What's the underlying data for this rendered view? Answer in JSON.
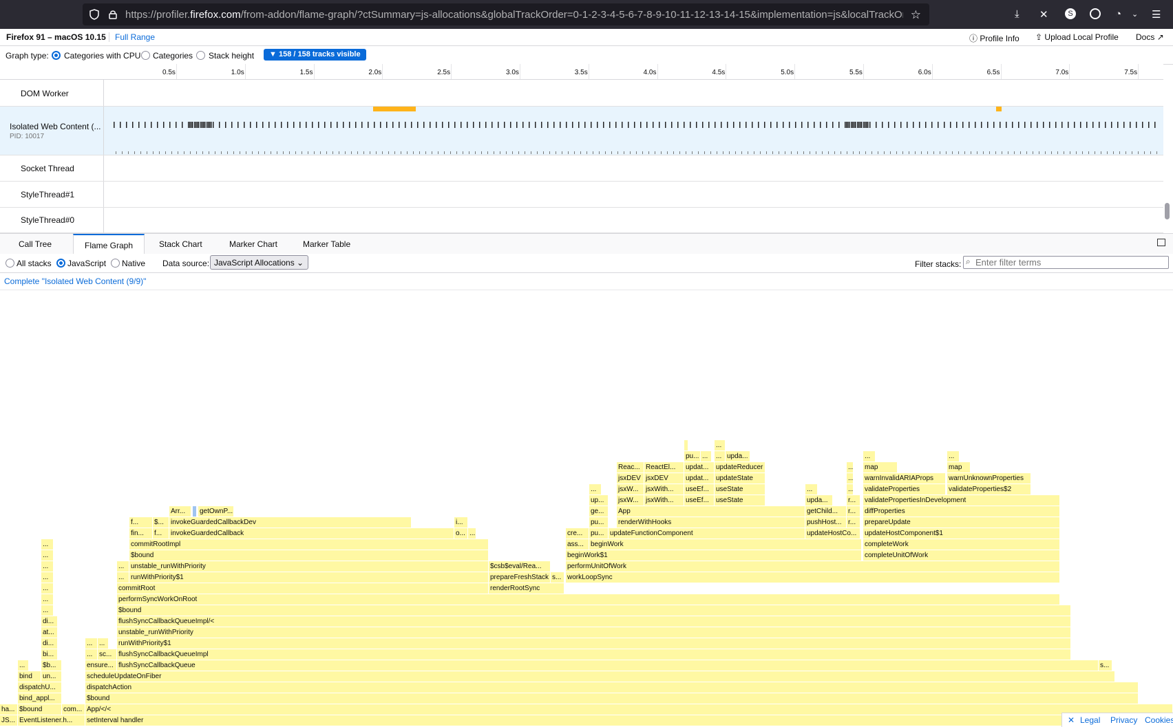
{
  "browser": {
    "url_scheme": "https://profiler.",
    "url_host": "firefox.com",
    "url_rest": "/from-addon/flame-graph/?ctSummary=js-allocations&globalTrackOrder=0-1-2-3-4-5-6-7-8-9-10-11-12-13-14-15&implementation=js&localTrackOrder"
  },
  "header": {
    "title": "Firefox 91 – macOS 10.15",
    "range": "Full Range",
    "profile_info": "Profile Info",
    "upload": "Upload Local Profile",
    "docs": "Docs"
  },
  "graph_type": {
    "label": "Graph type:",
    "options": [
      "Categories with CPU",
      "Categories",
      "Stack height"
    ],
    "selected": "Categories with CPU",
    "tracks_visible": "158 / 158 tracks visible"
  },
  "ruler": [
    "0.5s",
    "1.0s",
    "1.5s",
    "2.0s",
    "2.5s",
    "3.0s",
    "3.5s",
    "4.0s",
    "4.5s",
    "5.0s",
    "5.5s",
    "6.0s",
    "6.5s",
    "7.0s",
    "7.5s"
  ],
  "tracks": [
    {
      "name": "DOM Worker"
    },
    {
      "name": "Isolated Web Content (...",
      "pid": "PID: 10017"
    },
    {
      "name": "Socket Thread"
    },
    {
      "name": "StyleThread#1"
    },
    {
      "name": "StyleThread#0"
    }
  ],
  "tabs": [
    "Call Tree",
    "Flame Graph",
    "Stack Chart",
    "Marker Chart",
    "Marker Table"
  ],
  "active_tab": "Flame Graph",
  "settings": {
    "stack_options": [
      "All stacks",
      "JavaScript",
      "Native"
    ],
    "selected_stack": "JavaScript",
    "data_source_label": "Data source:",
    "data_source_value": "JavaScript Allocations",
    "filter_label": "Filter stacks:",
    "filter_placeholder": "Enter filter terms"
  },
  "breadcrumb": "Complete \"Isolated Web Content (9/9)\"",
  "footer": {
    "legal": "Legal",
    "privacy": "Privacy",
    "cookies": "Cookies"
  },
  "flame_frames": [
    [
      "JS...",
      0,
      0,
      26
    ],
    [
      "EventListener.h...",
      0,
      26,
      98
    ],
    [
      "setInterval handler",
      0,
      124,
      1580
    ],
    [
      "ha...",
      1,
      0,
      26
    ],
    [
      "$bound",
      1,
      26,
      64
    ],
    [
      "com...",
      1,
      90,
      34
    ],
    [
      "App/</<",
      1,
      124,
      1580
    ],
    [
      "bind_appl...",
      2,
      26,
      64
    ],
    [
      "$bound",
      2,
      124,
      1530
    ],
    [
      "dispatchU...",
      3,
      26,
      64
    ],
    [
      "dispatchAction",
      3,
      124,
      1530
    ],
    [
      "bind",
      4,
      26,
      34
    ],
    [
      "un...",
      4,
      60,
      30
    ],
    [
      "scheduleUpdateOnFiber",
      4,
      124,
      1496
    ],
    [
      "...",
      5,
      26,
      16
    ],
    [
      "$b...",
      5,
      60,
      30
    ],
    [
      "ensure...",
      5,
      124,
      46
    ],
    [
      "flushSyncCallbackQueue",
      5,
      170,
      1426
    ],
    [
      "s...",
      5,
      1596,
      20
    ],
    [
      "bi...",
      6,
      60,
      24
    ],
    [
      "...",
      6,
      124,
      18
    ],
    [
      "sc...",
      6,
      142,
      28
    ],
    [
      "flushSyncCallbackQueueImpl",
      6,
      170,
      1386
    ],
    [
      "di...",
      7,
      60,
      24
    ],
    [
      "...",
      7,
      124,
      18
    ],
    [
      "...",
      7,
      142,
      16
    ],
    [
      "runWithPriority$1",
      7,
      170,
      1386
    ],
    [
      "at...",
      8,
      60,
      24
    ],
    [
      "unstable_runWithPriority",
      8,
      170,
      1386
    ],
    [
      "di...",
      9,
      60,
      24
    ],
    [
      "flushSyncCallbackQueueImpl/<",
      9,
      170,
      1386
    ],
    [
      "...",
      10,
      60,
      18
    ],
    [
      "$bound",
      10,
      170,
      1386
    ],
    [
      "...",
      11,
      60,
      18
    ],
    [
      "performSyncWorkOnRoot",
      11,
      170,
      1370
    ],
    [
      "...",
      12,
      60,
      18
    ],
    [
      "commitRoot",
      12,
      170,
      540
    ],
    [
      "renderRootSync",
      12,
      710,
      110
    ],
    [
      "...",
      13,
      60,
      18
    ],
    [
      "...",
      13,
      170,
      18
    ],
    [
      "runWithPriority$1",
      13,
      188,
      522
    ],
    [
      "prepareFreshStack",
      13,
      710,
      90
    ],
    [
      "s...",
      13,
      800,
      20
    ],
    [
      "workLoopSync",
      13,
      822,
      718
    ],
    [
      "...",
      14,
      60,
      18
    ],
    [
      "...",
      14,
      170,
      18
    ],
    [
      "unstable_runWithPriority",
      14,
      188,
      522
    ],
    [
      "$csb$eval/Rea...",
      14,
      710,
      90
    ],
    [
      "performUnitOfWork",
      14,
      822,
      718
    ],
    [
      "...",
      15,
      60,
      18
    ],
    [
      "$bound",
      15,
      188,
      522
    ],
    [
      "beginWork$1",
      15,
      822,
      430
    ],
    [
      "completeUnitOfWork",
      15,
      1254,
      286
    ],
    [
      "...",
      16,
      60,
      18
    ],
    [
      "commitRootImpl",
      16,
      188,
      522
    ],
    [
      "ass...",
      16,
      822,
      34
    ],
    [
      "beginWork",
      16,
      856,
      396
    ],
    [
      "completeWork",
      16,
      1254,
      286
    ],
    [
      "fin...",
      17,
      188,
      34
    ],
    [
      "f...",
      17,
      222,
      24
    ],
    [
      "invokeGuardedCallback",
      17,
      246,
      414
    ],
    [
      "o...",
      17,
      660,
      20
    ],
    [
      "...",
      17,
      680,
      12
    ],
    [
      "cre...",
      17,
      822,
      34
    ],
    [
      "pu...",
      17,
      856,
      28
    ],
    [
      "updateFunctionComponent",
      17,
      884,
      286
    ],
    [
      "updateHostCo...",
      17,
      1170,
      80
    ],
    [
      "updateHostComponent$1",
      17,
      1254,
      286
    ],
    [
      "f...",
      18,
      188,
      34
    ],
    [
      "$...",
      18,
      222,
      24
    ],
    [
      "invokeGuardedCallbackDev",
      18,
      246,
      352
    ],
    [
      "i...",
      18,
      660,
      20
    ],
    [
      "pu...",
      18,
      856,
      28
    ],
    [
      "renderWithHooks",
      18,
      896,
      274
    ],
    [
      "pushHost...",
      18,
      1170,
      60
    ],
    [
      "r...",
      18,
      1230,
      20
    ],
    [
      "prepareUpdate",
      18,
      1254,
      286
    ],
    [
      "Arr...",
      19,
      246,
      32
    ],
    [
      "getOwnP...",
      19,
      288,
      52
    ],
    [
      "ge...",
      19,
      856,
      28
    ],
    [
      "App",
      19,
      896,
      274
    ],
    [
      "getChild...",
      19,
      1170,
      60
    ],
    [
      "r...",
      19,
      1230,
      20
    ],
    [
      "diffProperties",
      19,
      1254,
      286
    ],
    [
      "up...",
      20,
      856,
      28
    ],
    [
      "jsxW...",
      20,
      896,
      40
    ],
    [
      "jsxWith...",
      20,
      936,
      58
    ],
    [
      "useEf...",
      20,
      994,
      44
    ],
    [
      "useState",
      20,
      1038,
      74
    ],
    [
      "upda...",
      20,
      1170,
      40
    ],
    [
      "r...",
      20,
      1230,
      20
    ],
    [
      "validatePropertiesInDevelopment",
      20,
      1254,
      286
    ],
    [
      "...",
      21,
      856,
      18
    ],
    [
      "jsxW...",
      21,
      896,
      40
    ],
    [
      "jsxWith...",
      21,
      936,
      58
    ],
    [
      "useEf...",
      21,
      994,
      44
    ],
    [
      "useState",
      21,
      1038,
      74
    ],
    [
      "...",
      21,
      1170,
      18
    ],
    [
      "...",
      21,
      1230,
      10
    ],
    [
      "validateProperties",
      21,
      1254,
      120
    ],
    [
      "validateProperties$2",
      21,
      1376,
      122
    ],
    [
      "jsxDEV",
      22,
      896,
      40
    ],
    [
      "jsxDEV",
      22,
      936,
      58
    ],
    [
      "updat...",
      22,
      994,
      44
    ],
    [
      "updateState",
      22,
      1038,
      74
    ],
    [
      "...",
      22,
      1230,
      10
    ],
    [
      "warnInvalidARIAProps",
      22,
      1254,
      120
    ],
    [
      "warnUnknownProperties",
      22,
      1376,
      122
    ],
    [
      "Reac...",
      23,
      896,
      40
    ],
    [
      "ReactEl...",
      23,
      936,
      58
    ],
    [
      "updat...",
      23,
      994,
      44
    ],
    [
      "updateReducer",
      23,
      1038,
      74
    ],
    [
      "...",
      23,
      1230,
      10
    ],
    [
      "map",
      23,
      1254,
      50
    ],
    [
      "map",
      23,
      1376,
      34
    ],
    [
      "pu...",
      24,
      994,
      24
    ],
    [
      "...",
      24,
      1018,
      16
    ],
    [
      "...",
      24,
      1038,
      16
    ],
    [
      "upda...",
      24,
      1054,
      36
    ],
    [
      "...",
      24,
      1254,
      18
    ],
    [
      "...",
      24,
      1376,
      18
    ],
    [
      "",
      25,
      994,
      6
    ],
    [
      "...",
      25,
      1038,
      16
    ]
  ]
}
